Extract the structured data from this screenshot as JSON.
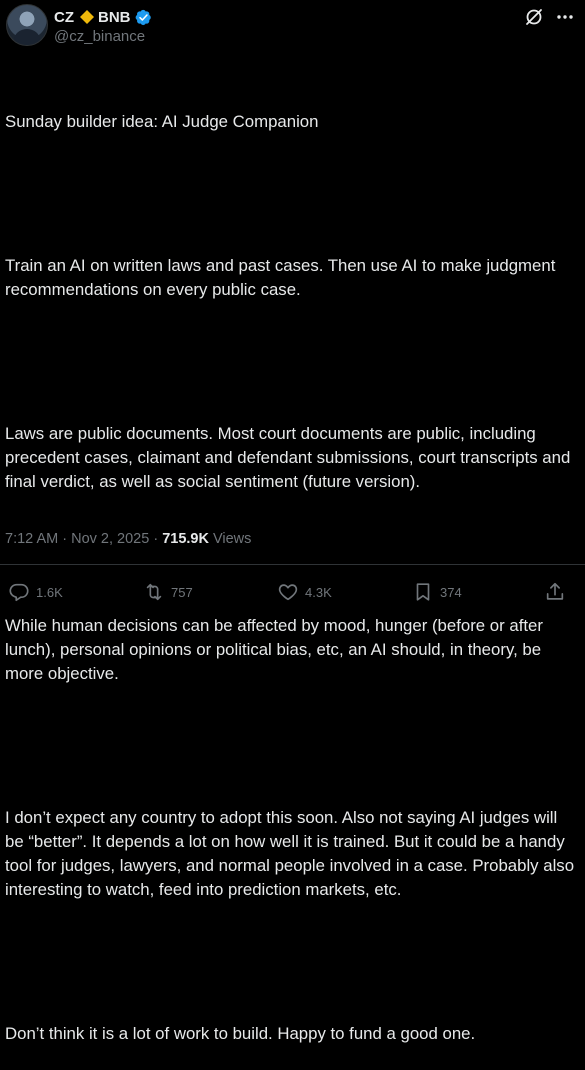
{
  "header": {
    "name_part1": "CZ",
    "name_part2": "BNB",
    "handle": "@cz_binance"
  },
  "post": {
    "lines": [
      "Sunday builder idea: AI Judge Companion",
      "",
      "Train an AI on written laws and past cases. Then use AI to make judgment recommendations on every public case.",
      "",
      "Laws are public documents. Most court documents are public, including precedent cases, claimant and defendant submissions, court transcripts and final verdict, as well as social sentiment (future version).",
      "",
      "While human decisions can be affected by mood, hunger (before or after lunch), personal opinions or political bias, etc, an AI should, in theory, be more objective.",
      "",
      "I don’t expect any country to adopt this soon. Also not saying AI judges will be “better”. It depends a lot on how well it is trained. But it could be a handy tool for judges, lawyers, and normal people involved in a case. Probably also interesting to watch, feed into prediction markets, etc.",
      "",
      "Don’t think it is a lot of work to build. Happy to fund a good one."
    ],
    "p1": "Sunday builder idea: AI Judge Companion",
    "p2": "Train an AI on written laws and past cases. Then use AI to make judgment recommendations on every public case.",
    "p3": "Laws are public documents. Most court documents are public, including precedent cases, claimant and defendant submissions, court transcripts and final verdict, as well as social sentiment (future version).",
    "p4": "While human decisions can be affected by mood, hunger (before or after lunch), personal opinions or political bias, etc, an AI should, in theory, be more objective.",
    "p5": "I don’t expect any country to adopt this soon. Also not saying AI judges will be “better”. It depends a lot on how well it is trained. But it could be a handy tool for judges, lawyers, and normal people involved in a case. Probably also interesting to watch, feed into prediction markets, etc.",
    "p6": "Don’t think it is a lot of work to build. Happy to fund a good one."
  },
  "meta": {
    "time": "7:12 AM",
    "sep1": " · ",
    "date": "Nov 2, 2025",
    "sep2": " · ",
    "views_count": "715.9K",
    "views_label": " Views"
  },
  "actions": {
    "replies": "1.6K",
    "reposts": "757",
    "likes": "4.3K",
    "bookmarks": "374"
  },
  "colors": {
    "background": "#000000",
    "text": "#e7e9ea",
    "muted": "#71767b",
    "verified": "#1d9bf0",
    "bnb": "#f0b90b"
  },
  "icons": [
    "diamond-icon",
    "verified-badge-icon",
    "grok-icon",
    "more-icon",
    "reply-icon",
    "repost-icon",
    "like-icon",
    "bookmark-icon",
    "share-icon"
  ]
}
